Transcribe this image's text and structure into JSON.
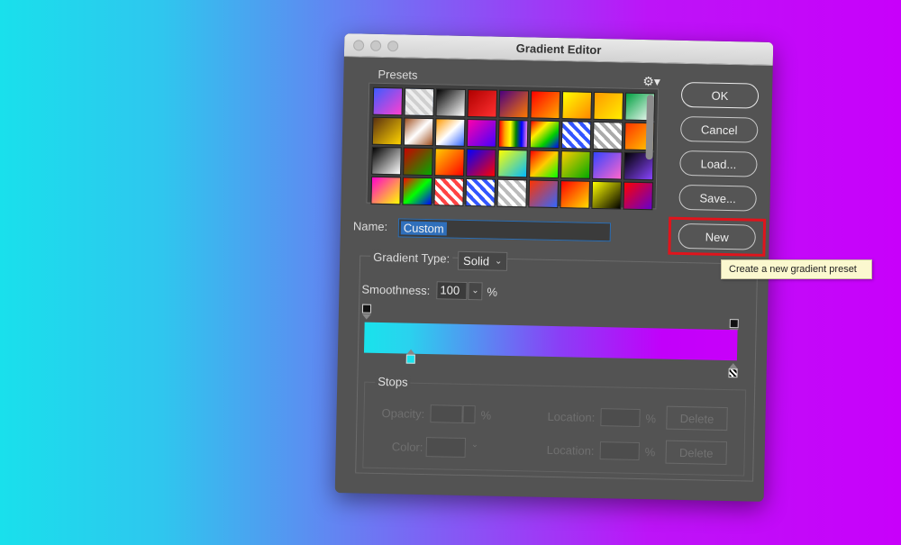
{
  "window": {
    "title": "Gradient Editor"
  },
  "presets": {
    "label": "Presets",
    "gear_icon": "gear-icon",
    "swatches": [
      "linear-gradient(135deg,#3c5cff,#ff3fd0)",
      "repeating-linear-gradient(45deg,#cfcfcf 0 4px,#eee 4px 8px), linear-gradient(90deg,#2277ff,#2277ff)",
      "linear-gradient(135deg,#000,#fff)",
      "linear-gradient(135deg,#b00000,#ff3030)",
      "linear-gradient(135deg,#4a0080,#ff7a00)",
      "linear-gradient(135deg,#ff0000,#ffaa00)",
      "linear-gradient(135deg,#ffff00,#ff8800)",
      "linear-gradient(135deg,#ff9900,#ffee00)",
      "linear-gradient(135deg,#00a040,#ffffff)",
      "linear-gradient(135deg,#5a3010,#ffd400)",
      "linear-gradient(135deg,#a05020,#ffffff,#a05020)",
      "linear-gradient(135deg,#ff9900,#ffffff,#3366ff)",
      "linear-gradient(135deg,#ff00aa,#4400ff)",
      "linear-gradient(90deg,red,orange,yellow,green,blue,violet)",
      "linear-gradient(135deg,#ff0000,#ffee00,#00cc00,#0000ff)",
      "repeating-linear-gradient(45deg,#3355ff 0 4px,#ffffff 4px 8px)",
      "repeating-linear-gradient(45deg,#aaaaaa 0 4px,#ffffff 4px 8px)",
      "linear-gradient(135deg,#ff3300,#ffcc00)",
      "linear-gradient(135deg,#000000,#ffffff)",
      "linear-gradient(135deg,#cc0000,#00aa00)",
      "linear-gradient(135deg,#ffcc00,#ff0000)",
      "linear-gradient(135deg,#0000ff,#ff0000)",
      "linear-gradient(135deg,#ffff00,#00bbff)",
      "linear-gradient(135deg,#ff0000,#ffcc00,#00ff00)",
      "linear-gradient(135deg,#ffcc00,#00aa00)",
      "linear-gradient(135deg,#3344ff,#ff66cc)",
      "linear-gradient(135deg,#000000,#8844ff)",
      "linear-gradient(135deg,#ff00cc,#ffff00)",
      "linear-gradient(135deg,#ff0000,#00ff00,#0000ff)",
      "repeating-linear-gradient(45deg,#ff4444 0 4px,#ffffff 4px 8px)",
      "repeating-linear-gradient(45deg,#3355ff 0 4px,#ffffff 4px 8px)",
      "repeating-linear-gradient(45deg,#bbbbbb 0 4px,#ffffff 4px 8px)",
      "linear-gradient(135deg,#ff3300,#3366ff)",
      "linear-gradient(135deg,#ff0000,#ffdd00)",
      "linear-gradient(135deg,#ffff00,#000000)",
      "linear-gradient(135deg,#ff0000,#6600cc)"
    ]
  },
  "buttons": {
    "ok": "OK",
    "cancel": "Cancel",
    "load": "Load...",
    "save": "Save...",
    "new": "New"
  },
  "name": {
    "label": "Name:",
    "value": "Custom"
  },
  "gradient_type": {
    "label": "Gradient Type:",
    "selected": "Solid"
  },
  "smoothness": {
    "label": "Smoothness:",
    "value": "100",
    "unit": "%"
  },
  "gradient": {
    "start_color": "#19e3ec",
    "end_color": "#c800fa"
  },
  "stops": {
    "label": "Stops",
    "opacity_label": "Opacity:",
    "opacity_unit": "%",
    "location_label_1": "Location:",
    "location_unit_1": "%",
    "delete_1": "Delete",
    "color_label": "Color:",
    "location_label_2": "Location:",
    "location_unit_2": "%",
    "delete_2": "Delete"
  },
  "tooltip": {
    "text": "Create a new gradient preset"
  },
  "colors": {
    "dialog_bg": "#535353",
    "highlight": "#e0141c",
    "selection": "#2f6fbb"
  }
}
